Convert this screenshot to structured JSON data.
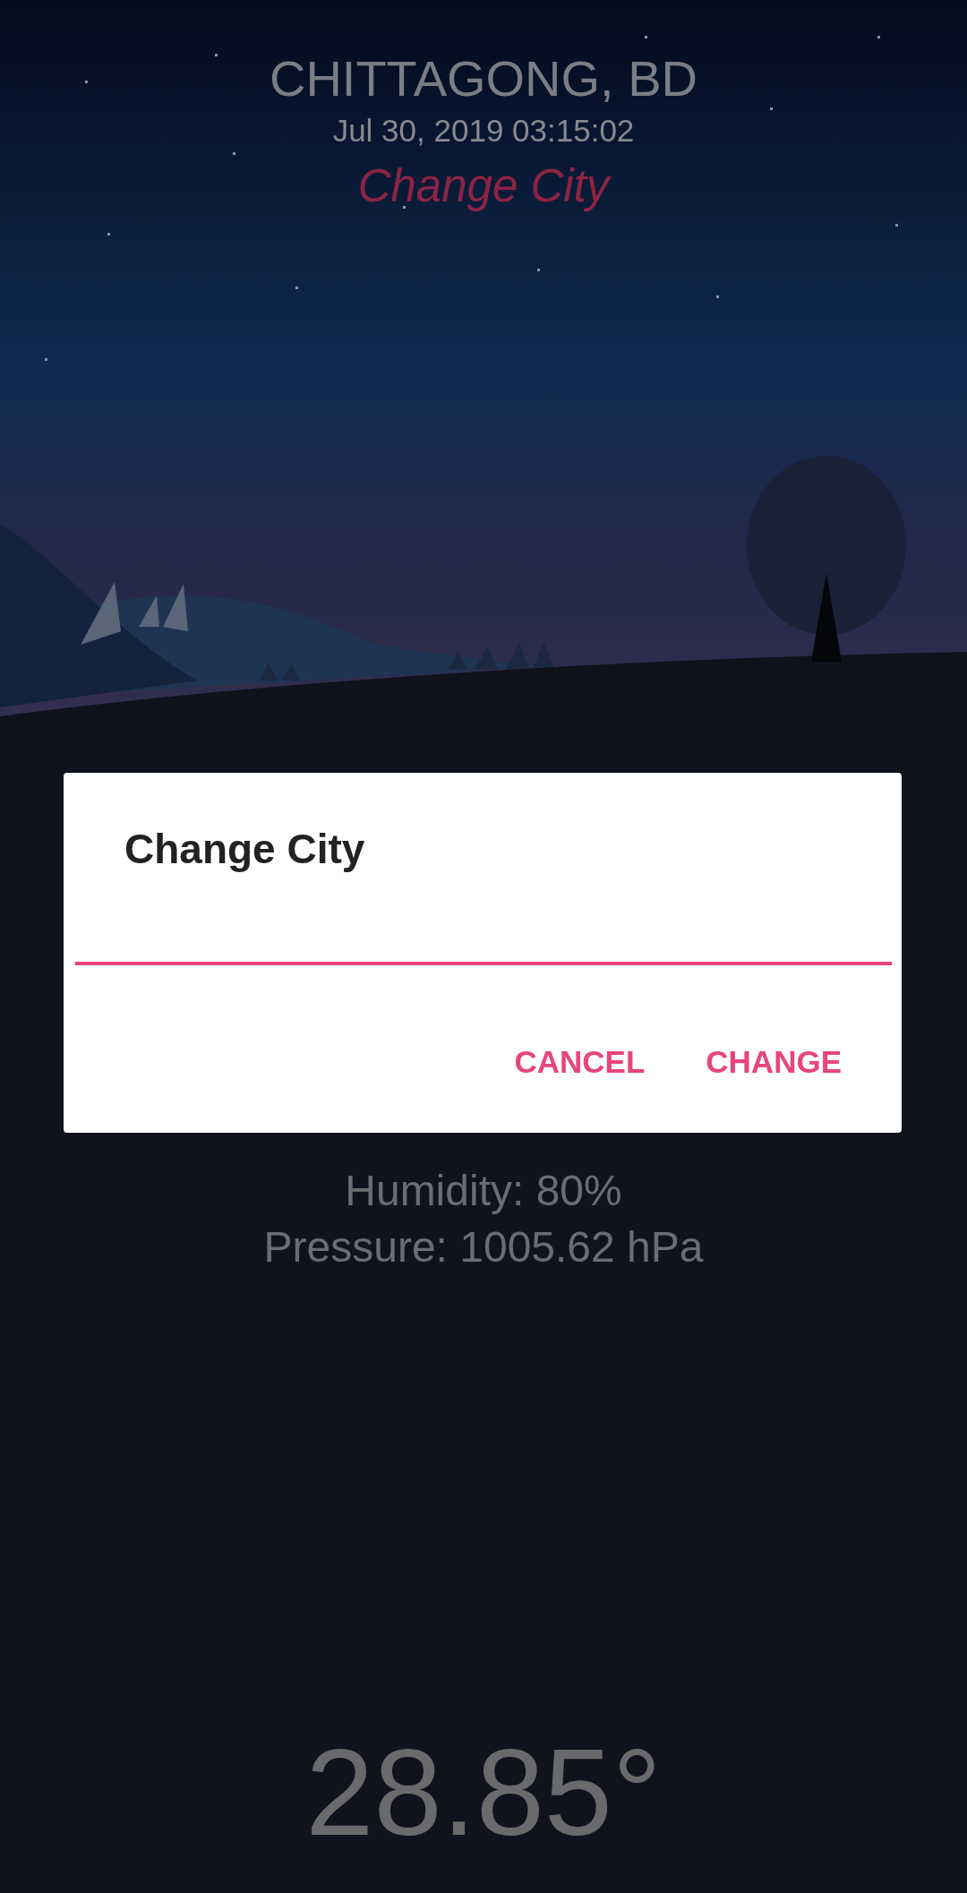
{
  "header": {
    "city": "CHITTAGONG, BD",
    "datetime": "Jul 30, 2019 03:15:02",
    "change_city_link": "Change City"
  },
  "weather": {
    "humidity": "Humidity: 80%",
    "pressure": "Pressure: 1005.62 hPa",
    "temperature": "28.85°"
  },
  "dialog": {
    "title": "Change City",
    "input": {
      "focused": true
    },
    "buttons": [
      {
        "label": "CANCEL"
      },
      {
        "label": "CHANGE"
      }
    ]
  }
}
